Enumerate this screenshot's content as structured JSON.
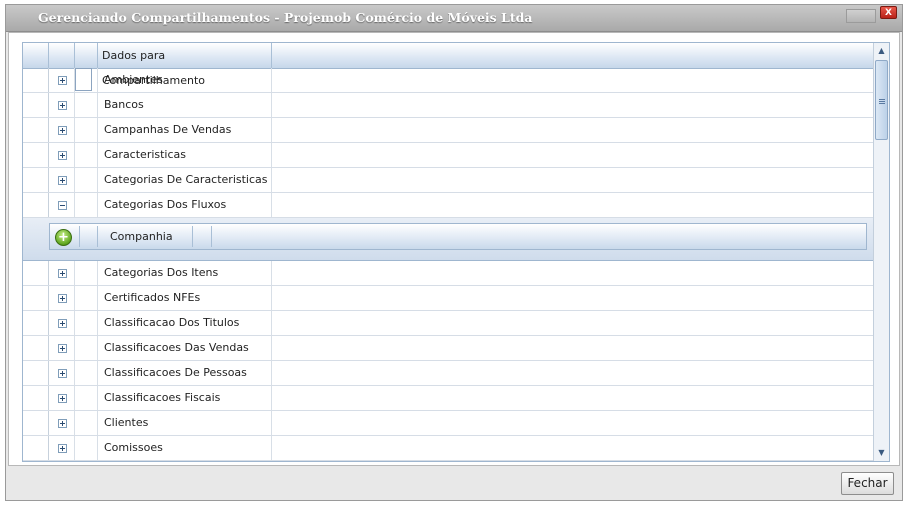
{
  "dialog": {
    "title": "Gerenciando Compartilhamentos - Projemob Comércio de Móveis Ltda",
    "close_label": "X"
  },
  "grid": {
    "column_header": "Dados para Compartilhamento",
    "rows": [
      {
        "label": "Ambientes",
        "expanded": false
      },
      {
        "label": "Bancos",
        "expanded": false
      },
      {
        "label": "Campanhas De Vendas",
        "expanded": false
      },
      {
        "label": "Caracteristicas",
        "expanded": false
      },
      {
        "label": "Categorias De Caracteristicas",
        "expanded": false
      },
      {
        "label": "Categorias Dos Fluxos",
        "expanded": true
      },
      {
        "label": "Categorias Dos Itens",
        "expanded": false
      },
      {
        "label": "Certificados NFEs",
        "expanded": false
      },
      {
        "label": "Classificacao Dos Titulos",
        "expanded": false
      },
      {
        "label": "Classificacoes Das Vendas",
        "expanded": false
      },
      {
        "label": "Classificacoes De Pessoas",
        "expanded": false
      },
      {
        "label": "Classificacoes Fiscais",
        "expanded": false
      },
      {
        "label": "Clientes",
        "expanded": false
      },
      {
        "label": "Comissoes",
        "expanded": false
      }
    ],
    "detail": {
      "column_header": "Companhia",
      "add_icon": "add-circle-icon"
    }
  },
  "footer": {
    "close_button": "Fechar"
  },
  "colors": {
    "header_blue": "#c6d7ea",
    "add_green": "#5ea51e",
    "close_red": "#c9302c"
  }
}
